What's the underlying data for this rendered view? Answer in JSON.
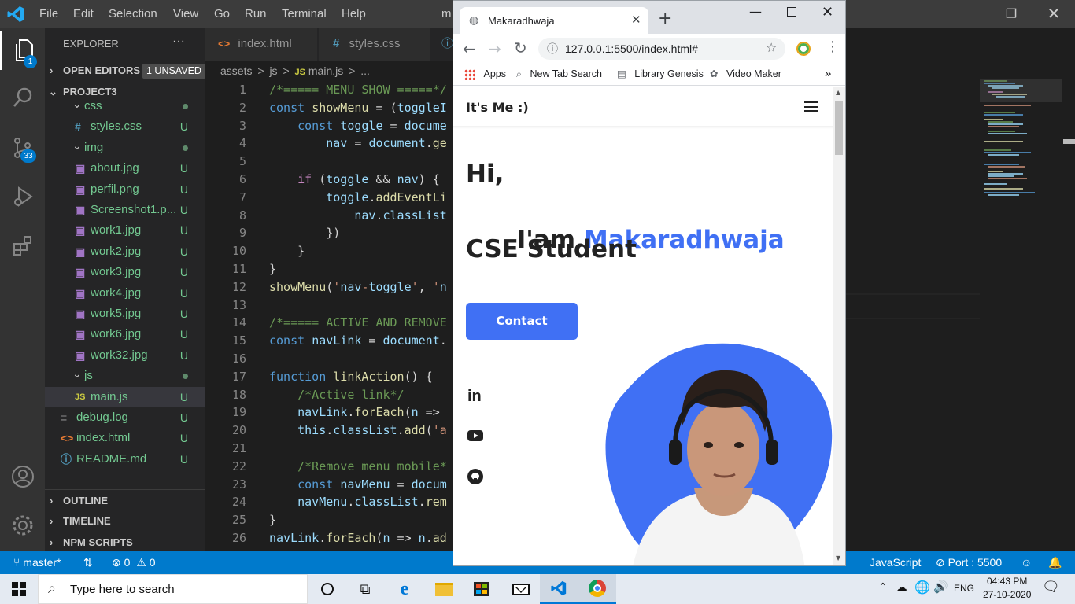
{
  "vscode": {
    "menu": [
      "File",
      "Edit",
      "Selection",
      "View",
      "Go",
      "Run",
      "Terminal",
      "Help"
    ],
    "title_fragment": "m",
    "activity_badges": {
      "explorer": "1",
      "scm": "33"
    },
    "explorer": {
      "title": "EXPLORER",
      "more": "···",
      "open_editors": "OPEN EDITORS",
      "unsaved_badge": "1 UNSAVED",
      "project": "PROJECT3",
      "files": [
        {
          "name": "css",
          "indent": 1,
          "kind": "folder",
          "status": "dot"
        },
        {
          "name": "styles.css",
          "indent": 2,
          "kind": "css",
          "status": "U"
        },
        {
          "name": "img",
          "indent": 1,
          "kind": "folder",
          "status": "dot"
        },
        {
          "name": "about.jpg",
          "indent": 2,
          "kind": "img",
          "status": "U"
        },
        {
          "name": "perfil.png",
          "indent": 2,
          "kind": "img",
          "status": "U"
        },
        {
          "name": "Screenshot1.p...",
          "indent": 2,
          "kind": "img",
          "status": "U"
        },
        {
          "name": "work1.jpg",
          "indent": 2,
          "kind": "img",
          "status": "U"
        },
        {
          "name": "work2.jpg",
          "indent": 2,
          "kind": "img",
          "status": "U"
        },
        {
          "name": "work3.jpg",
          "indent": 2,
          "kind": "img",
          "status": "U"
        },
        {
          "name": "work4.jpg",
          "indent": 2,
          "kind": "img",
          "status": "U"
        },
        {
          "name": "work5.jpg",
          "indent": 2,
          "kind": "img",
          "status": "U"
        },
        {
          "name": "work6.jpg",
          "indent": 2,
          "kind": "img",
          "status": "U"
        },
        {
          "name": "work32.jpg",
          "indent": 2,
          "kind": "img",
          "status": "U"
        },
        {
          "name": "js",
          "indent": 1,
          "kind": "folder",
          "status": "dot"
        },
        {
          "name": "main.js",
          "indent": 2,
          "kind": "js",
          "status": "U"
        },
        {
          "name": "debug.log",
          "indent": 0,
          "kind": "log",
          "status": "U"
        },
        {
          "name": "index.html",
          "indent": 0,
          "kind": "html",
          "status": "U"
        },
        {
          "name": "README.md",
          "indent": 0,
          "kind": "info",
          "status": "U"
        }
      ],
      "sections": [
        "OUTLINE",
        "TIMELINE",
        "NPM SCRIPTS"
      ]
    },
    "tabs": [
      {
        "label": "index.html",
        "icon": "<>"
      },
      {
        "label": "styles.css",
        "icon": "#"
      }
    ],
    "breadcrumb": [
      "assets",
      ">",
      "js",
      ">",
      "JS",
      "main.js",
      ">",
      "..."
    ],
    "code_lines": [
      "/*===== MENU SHOW =====*/",
      "const showMenu = (toggleI",
      "    const toggle = docume",
      "        nav = document.ge",
      "",
      "    if (toggle && nav) {",
      "        toggle.addEventLi",
      "            nav.classList",
      "        })",
      "    }",
      "}",
      "showMenu('nav-toggle', 'n",
      "",
      "/*===== ACTIVE AND REMOVE",
      "const navLink = document.",
      "",
      "function linkAction() {",
      "    /*Active link*/",
      "    navLink.forEach(n =>",
      "    this.classList.add('a",
      "",
      "    /*Remove menu mobile*",
      "    const navMenu = docum",
      "    navMenu.classList.rem",
      "}",
      "navLink.forEach(n => n.ad"
    ],
    "status": {
      "branch": "master*",
      "errors": "0",
      "warnings": "0",
      "language": "JavaScript",
      "port": "Port : 5500"
    }
  },
  "browser": {
    "tab_title": "Makaradhwaja",
    "url": "127.0.0.1:5500/index.html#",
    "bookmarks": [
      "Apps",
      "New Tab Search",
      "Library Genesis",
      "Video Maker"
    ],
    "more": "»",
    "page": {
      "brand": "It's Me :)",
      "hi": "Hi,",
      "iam": "I'am ",
      "name": "Makaradhwaja",
      "role": "CSE Student",
      "contact": "Contact",
      "accent": "#4070f4",
      "social": [
        "linkedin-icon",
        "youtube-icon",
        "github-icon"
      ]
    }
  },
  "taskbar": {
    "search_placeholder": "Type here to search",
    "lang": "ENG",
    "time": "04:43 PM",
    "date": "27-10-2020"
  }
}
